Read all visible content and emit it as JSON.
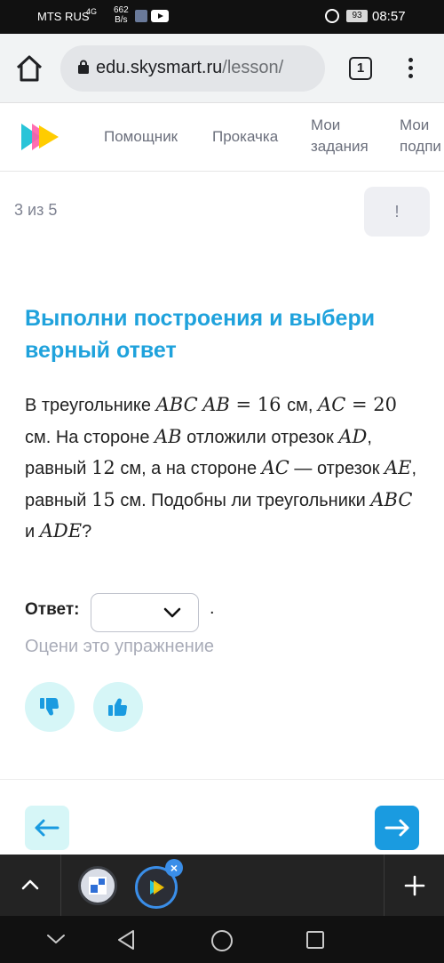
{
  "status_bar": {
    "carrier": "MTS RUS",
    "signal_text": "4G",
    "net_speed_value": "662",
    "net_speed_unit": "B/s",
    "battery": "93",
    "time": "08:57"
  },
  "browser": {
    "url_domain": "edu.skysmart.ru",
    "url_path": "/lesson/",
    "tab_count": "1"
  },
  "site_nav": {
    "items": [
      {
        "label": "Помощник"
      },
      {
        "label": "Прокачка"
      },
      {
        "label_line1": "Мои",
        "label_line2": "задания"
      },
      {
        "label_line1": "Мои",
        "label_line2": "подпи"
      }
    ]
  },
  "progress": {
    "counter": "3 из 5",
    "report_button": "!"
  },
  "exercise": {
    "title": "Выполни построения и выбери верный ответ",
    "text": {
      "t1": "В треугольнике ",
      "m1": "ABC",
      "m2": "AB",
      "eq1": " = 16 ",
      "t2": "см, ",
      "m3": "AC",
      "eq2": " = 20 ",
      "t3": "см. На стороне ",
      "m4": "AB",
      "t4": " отложили отрезок ",
      "m5": "AD",
      "t5": ", равный ",
      "n1": "12",
      "t6": " см, а на стороне ",
      "m6": "AC",
      "t7": " — отрезок ",
      "m7": "AE",
      "t8": ", равный ",
      "n2": "15",
      "t9": " см. Подобны ли треугольники ",
      "m8": "ABC",
      "t10": " и ",
      "m9": "ADE",
      "t11": "?"
    },
    "answer_label": "Ответ:",
    "answer_selected": "",
    "answer_suffix": ".",
    "rate_label": "Оцени это упражнение"
  },
  "colors": {
    "accent": "#1fa2dc",
    "light_accent": "#d6f6f7",
    "next_button": "#1a9be0"
  },
  "icons": {
    "home": "home-icon",
    "lock": "lock-icon",
    "menu": "more-vert-icon",
    "thumb_down": "thumb-down-icon",
    "thumb_up": "thumb-up-icon",
    "arrow_left": "arrow-left-icon",
    "arrow_right": "arrow-right-icon",
    "chevron_up": "chevron-up-icon",
    "plus": "plus-icon",
    "back": "back-triangle-icon",
    "home_circle": "home-circle-icon",
    "recents": "recents-square-icon"
  }
}
